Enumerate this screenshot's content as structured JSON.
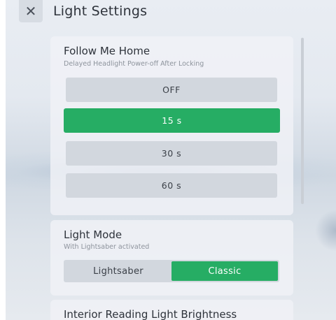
{
  "header": {
    "close_icon": "close-icon",
    "close_glyph": "✕",
    "title": "Light Settings"
  },
  "follow_me_home": {
    "title": "Follow Me Home",
    "subtitle": "Delayed Headlight Power-off After Locking",
    "options": [
      "OFF",
      "15 s",
      "30 s",
      "60 s"
    ],
    "selected": "15 s"
  },
  "light_mode": {
    "title": "Light Mode",
    "subtitle": "With Lightsaber activated",
    "options": [
      "Lightsaber",
      "Classic"
    ],
    "selected": "Classic"
  },
  "interior_reading_light": {
    "title": "Interior Reading Light Brightness"
  },
  "colors": {
    "accent": "#26ad64",
    "option_bg": "#d2d7de"
  }
}
